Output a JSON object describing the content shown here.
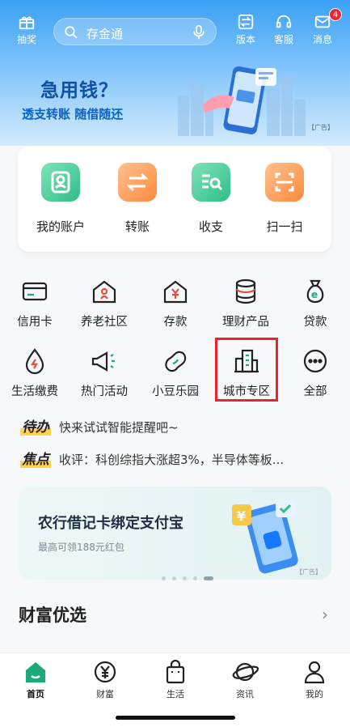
{
  "topbar": {
    "gift_label": "抽奖",
    "search_placeholder": "存金通",
    "version_label": "版本",
    "service_label": "客服",
    "message_label": "消息",
    "message_badge": "4"
  },
  "banner": {
    "title": "急用钱？",
    "subtitle": "透支转账 随借随还",
    "ad_tag": "【广告】"
  },
  "quick_actions": [
    {
      "label": "我的账户",
      "icon": "user-card-icon",
      "color": "#2fbf86"
    },
    {
      "label": "转账",
      "icon": "transfer-icon",
      "color": "#ff8a3d"
    },
    {
      "label": "收支",
      "icon": "ledger-search-icon",
      "color": "#2fbf86"
    },
    {
      "label": "扫一扫",
      "icon": "scan-icon",
      "color": "#ff8a3d"
    }
  ],
  "grid_row1": [
    {
      "label": "信用卡",
      "icon": "credit-card-icon"
    },
    {
      "label": "养老社区",
      "icon": "elderly-home-icon"
    },
    {
      "label": "存款",
      "icon": "deposit-house-icon"
    },
    {
      "label": "理财产品",
      "icon": "coin-stack-icon"
    },
    {
      "label": "贷款",
      "icon": "money-bag-icon"
    }
  ],
  "grid_row2": [
    {
      "label": "生活缴费",
      "icon": "utility-drop-icon"
    },
    {
      "label": "热门活动",
      "icon": "megaphone-icon"
    },
    {
      "label": "小豆乐园",
      "icon": "bean-icon"
    },
    {
      "label": "城市专区",
      "icon": "city-buildings-icon"
    },
    {
      "label": "全部",
      "icon": "more-dots-icon"
    }
  ],
  "notices": [
    {
      "tag": "待办",
      "text": "快来试试智能提醒吧~"
    },
    {
      "tag": "焦点",
      "text": "收评：科创综指大涨超3%，半导体等板..."
    }
  ],
  "promo": {
    "title": "农行借记卡绑定支付宝",
    "subtitle": "最高可领188元红包",
    "ad_tag": "【广告】"
  },
  "section": {
    "title": "财富优选",
    "arrow": "›"
  },
  "tabs": [
    {
      "label": "首页",
      "icon": "home-icon",
      "active": true
    },
    {
      "label": "财富",
      "icon": "yen-circle-icon",
      "active": false
    },
    {
      "label": "生活",
      "icon": "shopping-bag-icon",
      "active": false
    },
    {
      "label": "资讯",
      "icon": "planet-icon",
      "active": false
    },
    {
      "label": "我的",
      "icon": "person-icon",
      "active": false
    }
  ],
  "colors": {
    "brand_green": "#1aa97a",
    "accent_orange": "#ff8a3d",
    "highlight_red": "#e8252c"
  }
}
